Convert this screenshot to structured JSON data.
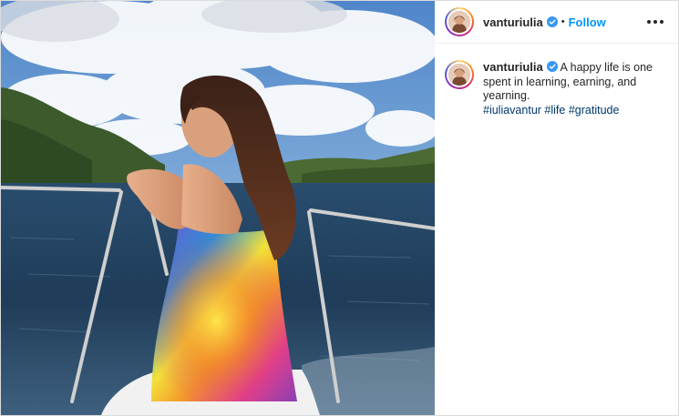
{
  "post": {
    "image_alt": "Woman in a tie-dye sarong sitting at the bow of a boat looking at the sea and hills",
    "author": {
      "username": "vanturiulia",
      "verified": true,
      "follow_label": "Follow",
      "separator": "•"
    },
    "caption": {
      "username": "vanturiulia",
      "text": " A happy life is one spent in learning, earning, and yearning.",
      "hashtags": [
        "#iuliavantur",
        "#life",
        "#gratitude"
      ]
    }
  },
  "colors": {
    "link_blue": "#0095f6",
    "hashtag_blue": "#00376b",
    "verified_blue": "#3897f0"
  },
  "icons": {
    "verified": "verified-badge-icon",
    "more": "more-options-icon"
  }
}
